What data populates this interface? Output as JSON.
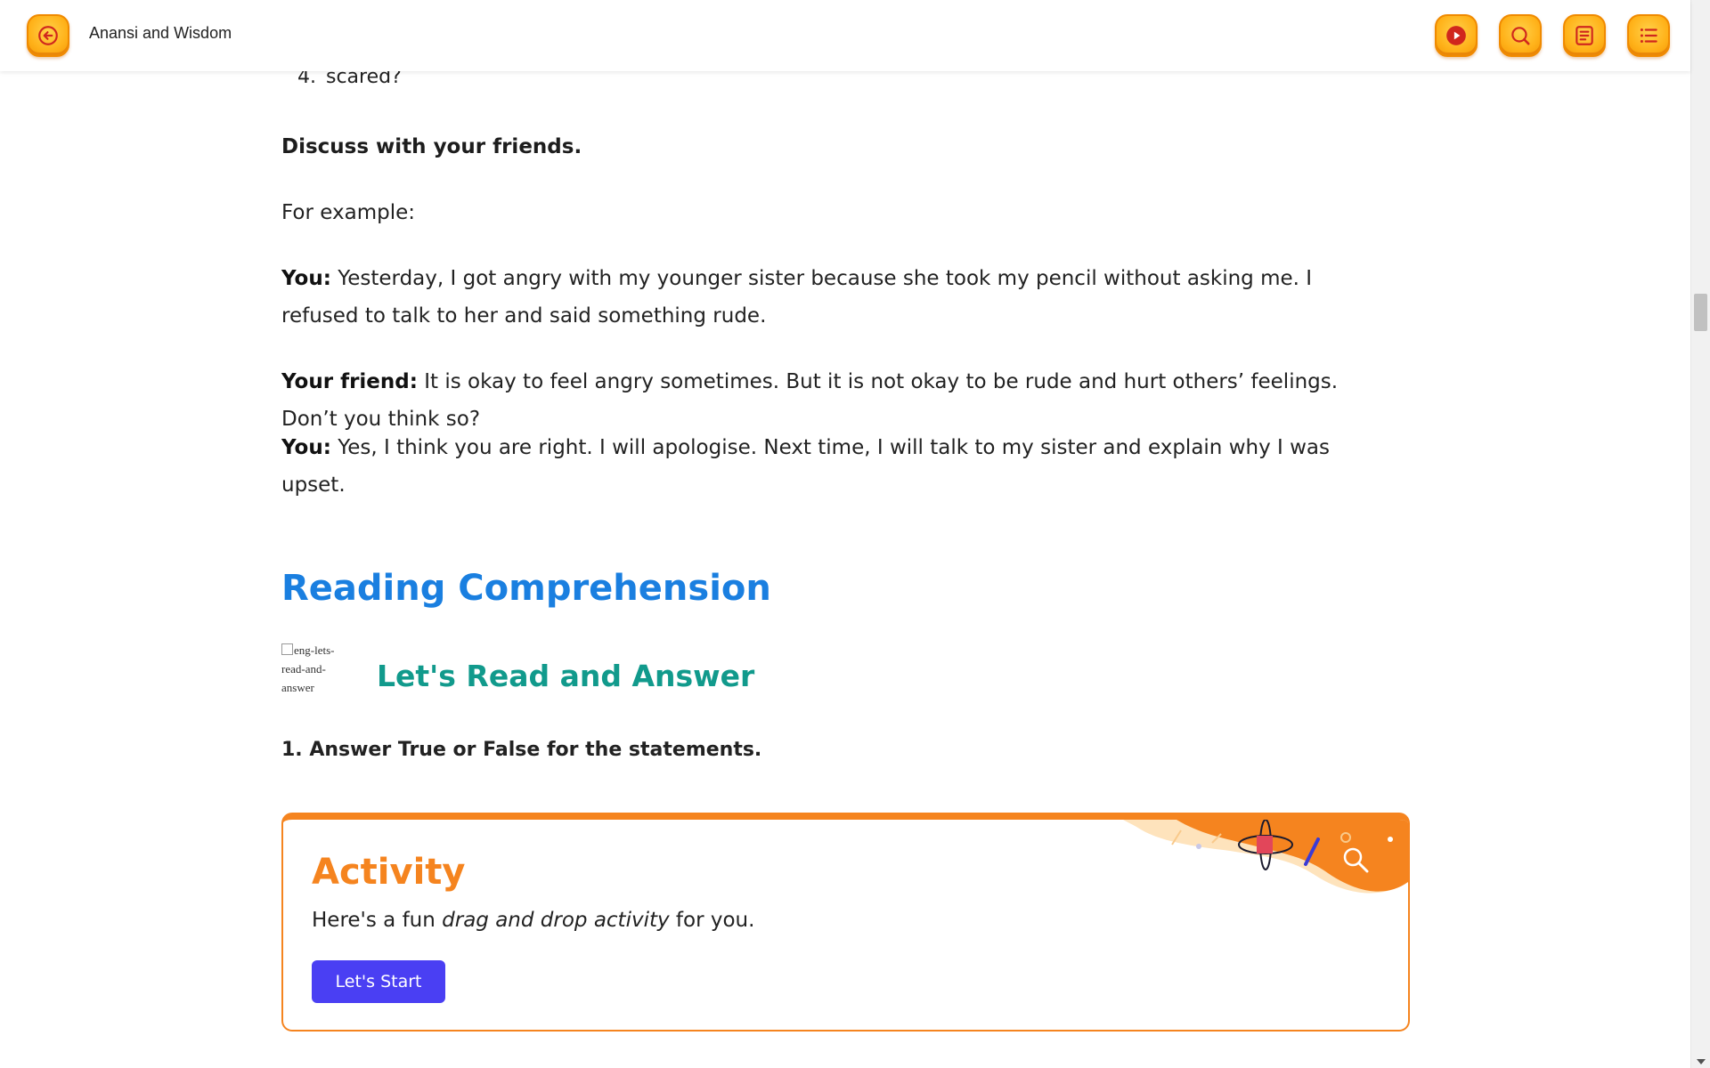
{
  "header": {
    "title": "Anansi and Wisdom",
    "buttons": {
      "back": "arrow-left-icon",
      "play": "play-icon",
      "search": "search-icon",
      "notes": "notes-icon",
      "menu": "list-icon"
    }
  },
  "content": {
    "list_item": {
      "number": "4.",
      "text": "scared?"
    },
    "discuss_heading": "Discuss with your friends.",
    "for_example": "For example:",
    "dialogue": [
      {
        "speaker": "You:",
        "text": " Yesterday, I got angry with my younger sister because she took my pencil without asking me. I refused to talk to her and said something rude."
      },
      {
        "speaker": "Your friend:",
        "text": " It is okay to feel angry sometimes. But it is not okay to be rude and hurt others’ feelings. Don’t you think so?"
      },
      {
        "speaker": "You:",
        "text": " Yes, I think you are right. I will apologise. Next time, I will talk to my sister and explain why I was upset."
      }
    ],
    "section_title": "Reading Comprehension",
    "broken_image_alt": "eng-lets-read-and-answer",
    "sub_title": "Let's Read and Answer",
    "question": "1. Answer True or False for the statements."
  },
  "activity": {
    "title": "Activity",
    "desc_before": "Here's a fun ",
    "desc_italic": "drag and drop activity",
    "desc_after": " for you.",
    "button_label": "Let's Start"
  },
  "colors": {
    "accent_orange": "#f5841f",
    "button_yellow": "#ffb21a",
    "section_blue": "#1a7fe0",
    "subtitle_teal": "#119a8c",
    "start_button": "#4a3ff3"
  }
}
